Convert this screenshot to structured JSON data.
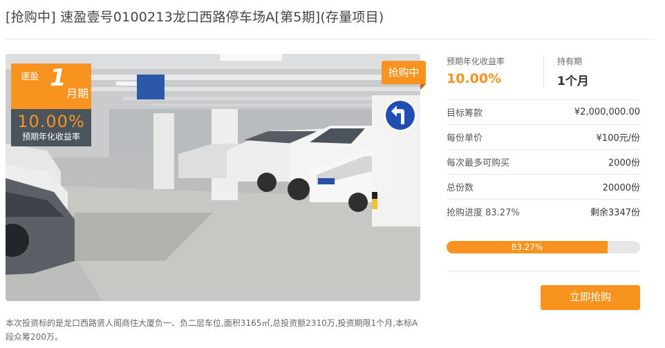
{
  "title": "[抢购中] 速盈壹号0100213龙口西路停车场A[第5期](存量项目)",
  "badge": {
    "product": "速盈",
    "term_number": "1",
    "term_unit": "月期",
    "rate": "10.00%",
    "rate_label": "预期年化收益率"
  },
  "status_tag": "抢购中",
  "description": "本次投资标的是龙口西路贤人阁商住大厦负一、负二层车位,面积3165㎡,总投资额2310万,投资期限1个月,本标A段众筹200万。",
  "info": {
    "rate_caption": "预期年化收益率",
    "rate_value": "10.00%",
    "term_caption": "持有期",
    "term_value": "1个月",
    "rows": [
      {
        "label": "目标筹款",
        "value": "¥2,000,000.00"
      },
      {
        "label": "每份单价",
        "value": "¥100元/份"
      },
      {
        "label": "每次最多可购买",
        "value": "2000份"
      },
      {
        "label": "总份数",
        "value": "20000份"
      },
      {
        "label": "抢购进度 83.27%",
        "value": "剩余3347份"
      }
    ],
    "progress_fraction": 0.8327,
    "progress_label": "83.27%",
    "buy_label": "立即抢购"
  },
  "colors": {
    "accent": "#f7931e",
    "sign_blue": "#1f4fb5"
  }
}
